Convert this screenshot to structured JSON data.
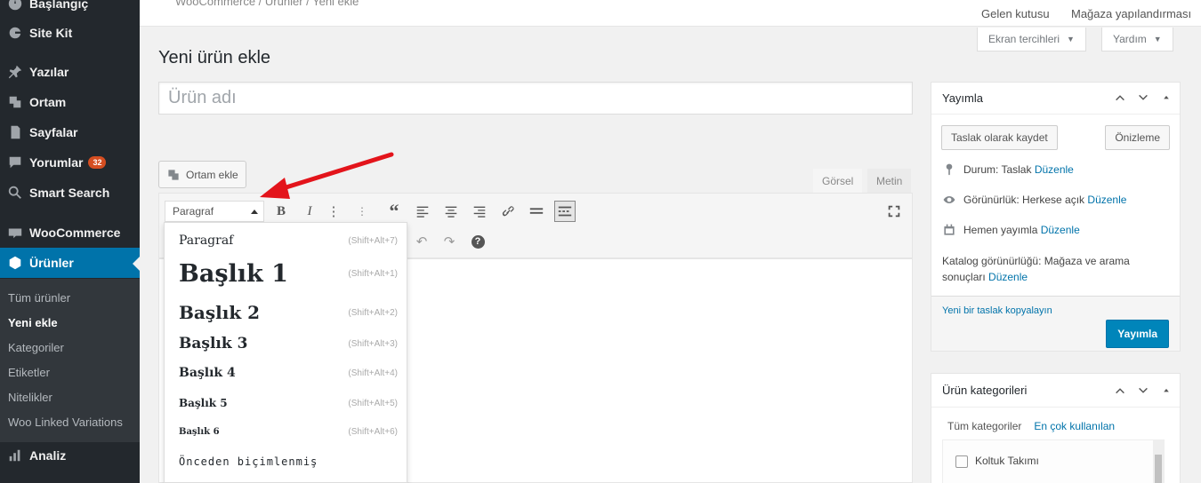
{
  "sidebar": {
    "items": [
      {
        "label": "Başlangıç",
        "icon": "dashboard-icon"
      },
      {
        "label": "Site Kit",
        "icon": "google-icon"
      },
      {
        "label": "Yazılar",
        "icon": "pin-icon"
      },
      {
        "label": "Ortam",
        "icon": "media-icon"
      },
      {
        "label": "Sayfalar",
        "icon": "pages-icon"
      },
      {
        "label": "Yorumlar",
        "icon": "comments-icon",
        "badge": "32"
      },
      {
        "label": "Smart Search",
        "icon": "search-icon"
      },
      {
        "label": "WooCommerce",
        "icon": "woocommerce-icon"
      },
      {
        "label": "Ürünler",
        "icon": "products-icon"
      },
      {
        "label": "Analiz",
        "icon": "analytics-icon"
      }
    ],
    "submenu": [
      "Tüm ürünler",
      "Yeni ekle",
      "Kategoriler",
      "Etiketler",
      "Nitelikler",
      "Woo Linked Variations"
    ]
  },
  "topbar": {
    "breadcrumb": "WooCommerce / Ürünler / Yeni ekle",
    "inbox": "Gelen kutusu",
    "store_setup": "Mağaza yapılandırması",
    "screen_options": "Ekran tercihleri",
    "help": "Yardım"
  },
  "page": {
    "title": "Yeni ürün ekle",
    "product_name_placeholder": "Ürün adı"
  },
  "editor": {
    "add_media": "Ortam ekle",
    "tab_visual": "Görsel",
    "tab_text": "Metin",
    "format_selected": "Paragraf",
    "formats": [
      {
        "label": "Paragraf",
        "shortcut": "(Shift+Alt+7)"
      },
      {
        "label": "Başlık 1",
        "shortcut": "(Shift+Alt+1)"
      },
      {
        "label": "Başlık 2",
        "shortcut": "(Shift+Alt+2)"
      },
      {
        "label": "Başlık 3",
        "shortcut": "(Shift+Alt+3)"
      },
      {
        "label": "Başlık 4",
        "shortcut": "(Shift+Alt+4)"
      },
      {
        "label": "Başlık 5",
        "shortcut": "(Shift+Alt+5)"
      },
      {
        "label": "Başlık 6",
        "shortcut": "(Shift+Alt+6)"
      },
      {
        "label": "Önceden biçimlenmiş",
        "shortcut": ""
      }
    ]
  },
  "publish": {
    "title": "Yayımla",
    "save_draft": "Taslak olarak kaydet",
    "preview": "Önizleme",
    "status_label": "Durum: Taslak",
    "visibility_label": "Görünürlük: Herkese açık",
    "schedule_label": "Hemen yayımla",
    "edit": "Düzenle",
    "catalog_text": "Katalog görünürlüğü: Mağaza ve arama sonuçları",
    "copy_draft": "Yeni bir taslak kopyalayın",
    "publish_button": "Yayımla"
  },
  "categories": {
    "title": "Ürün kategorileri",
    "tab_all": "Tüm kategoriler",
    "tab_popular": "En çok kullanılan",
    "items": [
      "Koltuk Takımı"
    ]
  },
  "colors": {
    "accent": "#0073aa",
    "sidebar": "#23282d",
    "badge": "#d54e21",
    "arrow": "#e3141b"
  }
}
